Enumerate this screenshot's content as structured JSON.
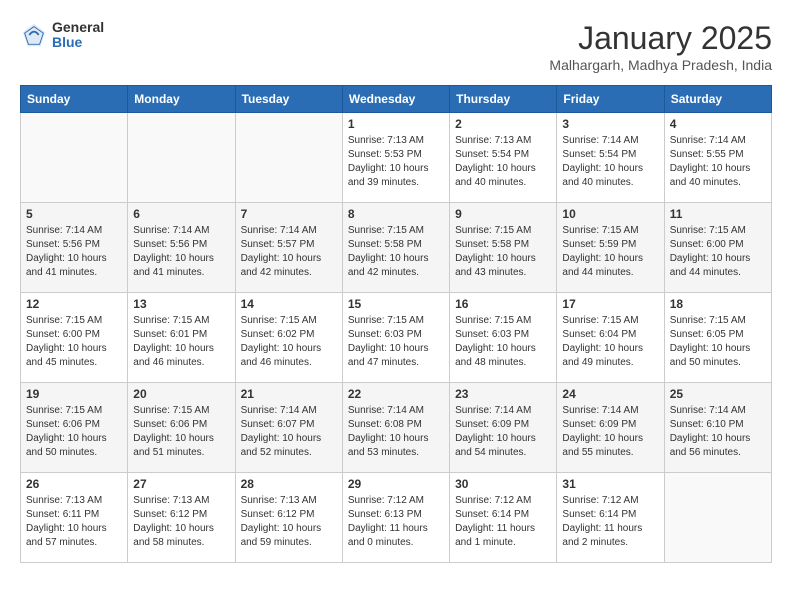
{
  "logo": {
    "general": "General",
    "blue": "Blue"
  },
  "header": {
    "month": "January 2025",
    "location": "Malhargarh, Madhya Pradesh, India"
  },
  "days_of_week": [
    "Sunday",
    "Monday",
    "Tuesday",
    "Wednesday",
    "Thursday",
    "Friday",
    "Saturday"
  ],
  "weeks": [
    [
      {
        "day": "",
        "content": ""
      },
      {
        "day": "",
        "content": ""
      },
      {
        "day": "",
        "content": ""
      },
      {
        "day": "1",
        "content": "Sunrise: 7:13 AM\nSunset: 5:53 PM\nDaylight: 10 hours\nand 39 minutes."
      },
      {
        "day": "2",
        "content": "Sunrise: 7:13 AM\nSunset: 5:54 PM\nDaylight: 10 hours\nand 40 minutes."
      },
      {
        "day": "3",
        "content": "Sunrise: 7:14 AM\nSunset: 5:54 PM\nDaylight: 10 hours\nand 40 minutes."
      },
      {
        "day": "4",
        "content": "Sunrise: 7:14 AM\nSunset: 5:55 PM\nDaylight: 10 hours\nand 40 minutes."
      }
    ],
    [
      {
        "day": "5",
        "content": "Sunrise: 7:14 AM\nSunset: 5:56 PM\nDaylight: 10 hours\nand 41 minutes."
      },
      {
        "day": "6",
        "content": "Sunrise: 7:14 AM\nSunset: 5:56 PM\nDaylight: 10 hours\nand 41 minutes."
      },
      {
        "day": "7",
        "content": "Sunrise: 7:14 AM\nSunset: 5:57 PM\nDaylight: 10 hours\nand 42 minutes."
      },
      {
        "day": "8",
        "content": "Sunrise: 7:15 AM\nSunset: 5:58 PM\nDaylight: 10 hours\nand 42 minutes."
      },
      {
        "day": "9",
        "content": "Sunrise: 7:15 AM\nSunset: 5:58 PM\nDaylight: 10 hours\nand 43 minutes."
      },
      {
        "day": "10",
        "content": "Sunrise: 7:15 AM\nSunset: 5:59 PM\nDaylight: 10 hours\nand 44 minutes."
      },
      {
        "day": "11",
        "content": "Sunrise: 7:15 AM\nSunset: 6:00 PM\nDaylight: 10 hours\nand 44 minutes."
      }
    ],
    [
      {
        "day": "12",
        "content": "Sunrise: 7:15 AM\nSunset: 6:00 PM\nDaylight: 10 hours\nand 45 minutes."
      },
      {
        "day": "13",
        "content": "Sunrise: 7:15 AM\nSunset: 6:01 PM\nDaylight: 10 hours\nand 46 minutes."
      },
      {
        "day": "14",
        "content": "Sunrise: 7:15 AM\nSunset: 6:02 PM\nDaylight: 10 hours\nand 46 minutes."
      },
      {
        "day": "15",
        "content": "Sunrise: 7:15 AM\nSunset: 6:03 PM\nDaylight: 10 hours\nand 47 minutes."
      },
      {
        "day": "16",
        "content": "Sunrise: 7:15 AM\nSunset: 6:03 PM\nDaylight: 10 hours\nand 48 minutes."
      },
      {
        "day": "17",
        "content": "Sunrise: 7:15 AM\nSunset: 6:04 PM\nDaylight: 10 hours\nand 49 minutes."
      },
      {
        "day": "18",
        "content": "Sunrise: 7:15 AM\nSunset: 6:05 PM\nDaylight: 10 hours\nand 50 minutes."
      }
    ],
    [
      {
        "day": "19",
        "content": "Sunrise: 7:15 AM\nSunset: 6:06 PM\nDaylight: 10 hours\nand 50 minutes."
      },
      {
        "day": "20",
        "content": "Sunrise: 7:15 AM\nSunset: 6:06 PM\nDaylight: 10 hours\nand 51 minutes."
      },
      {
        "day": "21",
        "content": "Sunrise: 7:14 AM\nSunset: 6:07 PM\nDaylight: 10 hours\nand 52 minutes."
      },
      {
        "day": "22",
        "content": "Sunrise: 7:14 AM\nSunset: 6:08 PM\nDaylight: 10 hours\nand 53 minutes."
      },
      {
        "day": "23",
        "content": "Sunrise: 7:14 AM\nSunset: 6:09 PM\nDaylight: 10 hours\nand 54 minutes."
      },
      {
        "day": "24",
        "content": "Sunrise: 7:14 AM\nSunset: 6:09 PM\nDaylight: 10 hours\nand 55 minutes."
      },
      {
        "day": "25",
        "content": "Sunrise: 7:14 AM\nSunset: 6:10 PM\nDaylight: 10 hours\nand 56 minutes."
      }
    ],
    [
      {
        "day": "26",
        "content": "Sunrise: 7:13 AM\nSunset: 6:11 PM\nDaylight: 10 hours\nand 57 minutes."
      },
      {
        "day": "27",
        "content": "Sunrise: 7:13 AM\nSunset: 6:12 PM\nDaylight: 10 hours\nand 58 minutes."
      },
      {
        "day": "28",
        "content": "Sunrise: 7:13 AM\nSunset: 6:12 PM\nDaylight: 10 hours\nand 59 minutes."
      },
      {
        "day": "29",
        "content": "Sunrise: 7:12 AM\nSunset: 6:13 PM\nDaylight: 11 hours\nand 0 minutes."
      },
      {
        "day": "30",
        "content": "Sunrise: 7:12 AM\nSunset: 6:14 PM\nDaylight: 11 hours\nand 1 minute."
      },
      {
        "day": "31",
        "content": "Sunrise: 7:12 AM\nSunset: 6:14 PM\nDaylight: 11 hours\nand 2 minutes."
      },
      {
        "day": "",
        "content": ""
      }
    ]
  ]
}
